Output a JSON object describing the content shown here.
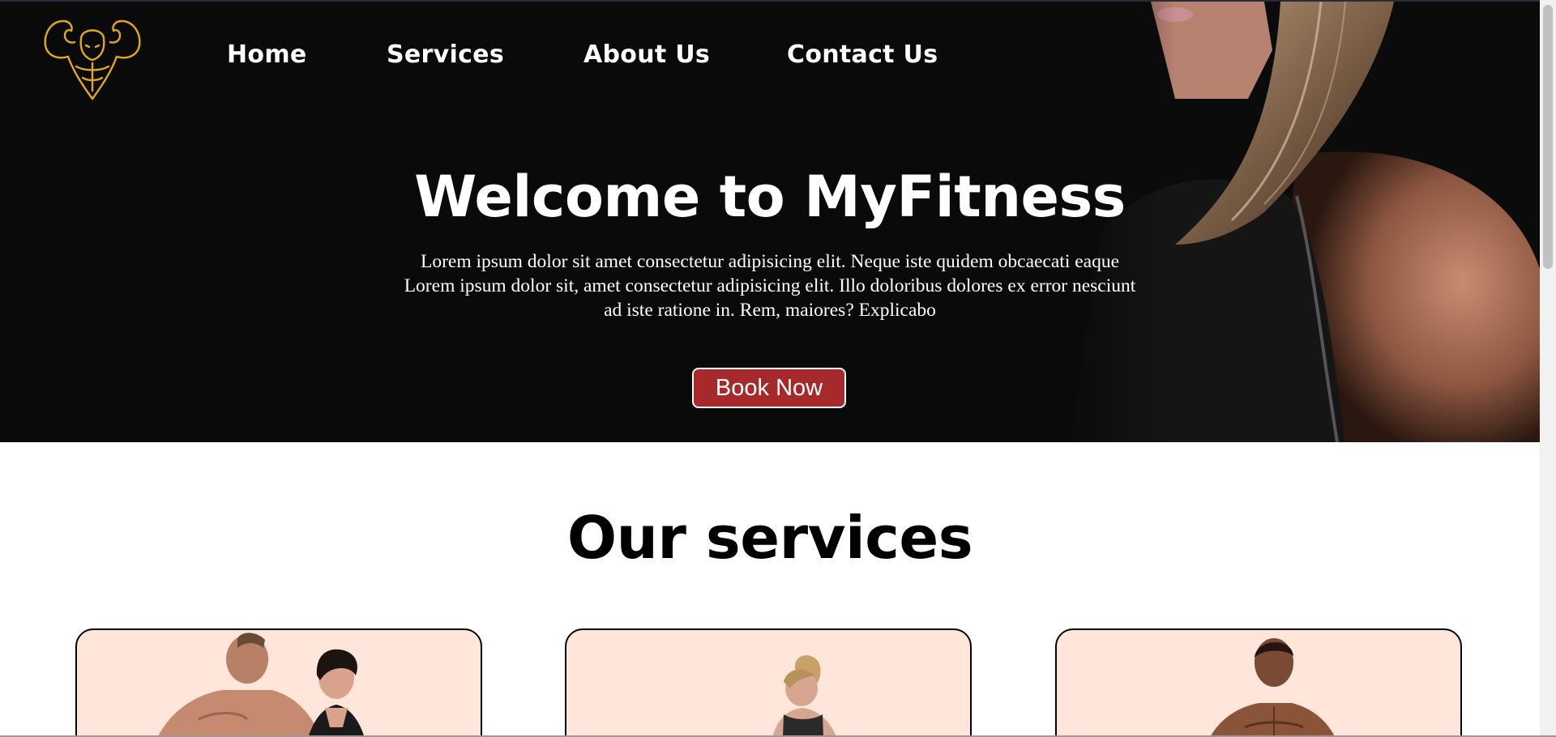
{
  "nav": {
    "items": [
      {
        "label": "Home"
      },
      {
        "label": "Services"
      },
      {
        "label": "About Us"
      },
      {
        "label": "Contact Us"
      }
    ]
  },
  "hero": {
    "title": "Welcome to MyFitness",
    "text_lines": [
      "Lorem ipsum dolor sit amet consectetur adipisicing elit. Neque iste quidem obcaecati eaque",
      "Lorem ipsum dolor sit, amet consectetur adipisicing elit. Illo doloribus dolores ex error nesciunt",
      "ad iste ratione in. Rem, maiores? Explicabo"
    ],
    "cta_label": "Book Now"
  },
  "services": {
    "title": "Our services",
    "cards": [
      {
        "image": "couple-fitness-photo"
      },
      {
        "image": "woman-workout-photo"
      },
      {
        "image": "man-bodybuilder-photo"
      }
    ]
  },
  "colors": {
    "hero_bg": "#0a0a0a",
    "logo_gold": "#e1a81c",
    "cta_red": "#a62a2b",
    "card_bg": "#ffe5da"
  },
  "icons": {
    "logo": "muscle-man-logo-icon"
  }
}
